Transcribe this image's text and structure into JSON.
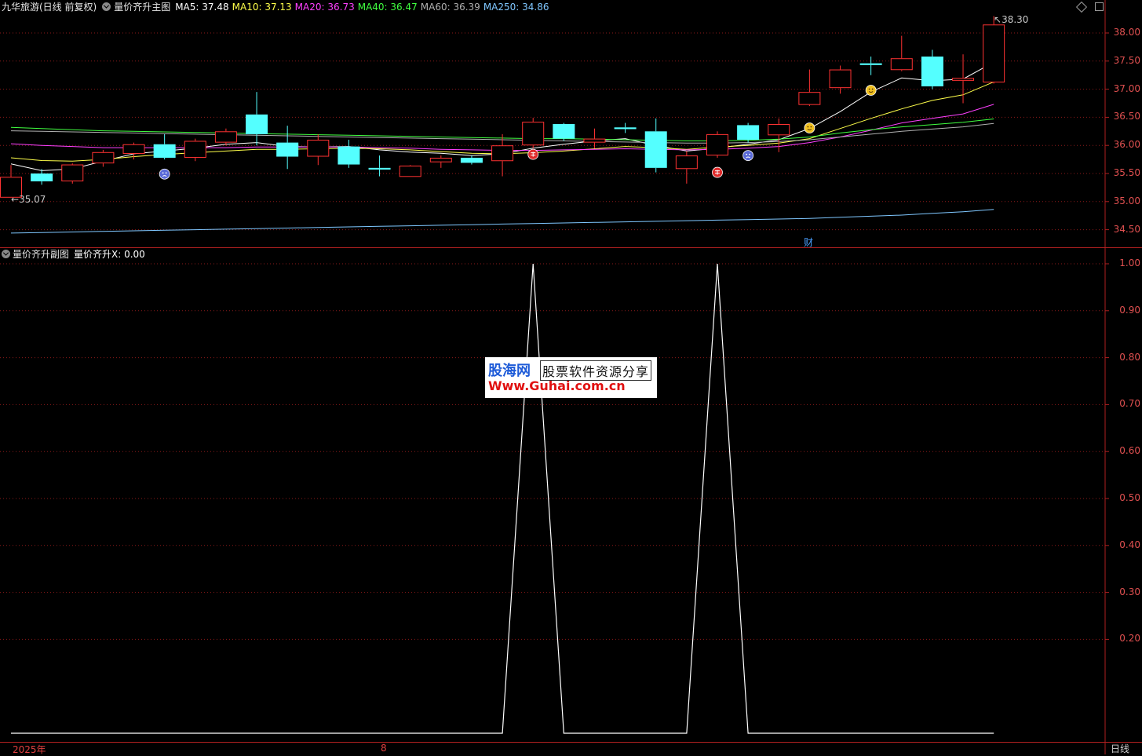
{
  "header": {
    "stock": "九华旅游(日线 前复权)",
    "indicator": "量价齐升主图",
    "ma": [
      {
        "label": "MA5: 37.48",
        "color": "#ffffff"
      },
      {
        "label": "MA10: 37.13",
        "color": "#ffff4a"
      },
      {
        "label": "MA20: 36.73",
        "color": "#ff40ff"
      },
      {
        "label": "MA40: 36.47",
        "color": "#40ff40"
      },
      {
        "label": "MA60: 36.39",
        "color": "#b0b0b0"
      },
      {
        "label": "MA250: 34.86",
        "color": "#7fc7ff"
      }
    ]
  },
  "sub_header": {
    "indicator": "量价齐升副图",
    "value": "量价齐升X: 0.00"
  },
  "main_axis": [
    "38.00",
    "37.50",
    "37.00",
    "36.50",
    "36.00",
    "35.50",
    "35.00",
    "34.50"
  ],
  "sub_axis": [
    "1.00",
    "0.90",
    "0.80",
    "0.70",
    "0.60",
    "0.50",
    "0.40",
    "0.30",
    "0.20"
  ],
  "price_marks": {
    "high": "38.30",
    "low": "35.07"
  },
  "event_label": "财",
  "dates": {
    "year": "2025年",
    "month": "8"
  },
  "period": "日线",
  "watermark": {
    "name": "股海网",
    "slogan": "股票软件资源分享",
    "url": "Www.Guhai.com.cn"
  },
  "colors": {
    "up": "#ff3232",
    "down": "#54ffff",
    "grid": "#8b1a1a",
    "signal": "#ffffff"
  },
  "chart_data": {
    "type": "candlestick",
    "ylim": [
      34.4,
      38.25
    ],
    "candles": [
      {
        "o": 35.44,
        "h": 35.65,
        "l": 35.07,
        "c": 35.07,
        "d": "up"
      },
      {
        "o": 35.5,
        "h": 35.58,
        "l": 35.3,
        "c": 35.36,
        "d": "down"
      },
      {
        "o": 35.36,
        "h": 35.68,
        "l": 35.32,
        "c": 35.66,
        "d": "up"
      },
      {
        "o": 35.68,
        "h": 35.92,
        "l": 35.62,
        "c": 35.88,
        "d": "up"
      },
      {
        "o": 35.85,
        "h": 36.05,
        "l": 35.75,
        "c": 36.02,
        "d": "up"
      },
      {
        "o": 36.02,
        "h": 36.2,
        "l": 35.75,
        "c": 35.78,
        "d": "down"
      },
      {
        "o": 35.78,
        "h": 36.12,
        "l": 35.72,
        "c": 36.08,
        "d": "up"
      },
      {
        "o": 36.05,
        "h": 36.3,
        "l": 36.0,
        "c": 36.25,
        "d": "up"
      },
      {
        "o": 36.55,
        "h": 36.95,
        "l": 36.0,
        "c": 36.2,
        "d": "down"
      },
      {
        "o": 36.05,
        "h": 36.35,
        "l": 35.58,
        "c": 35.8,
        "d": "down"
      },
      {
        "o": 35.8,
        "h": 36.2,
        "l": 35.65,
        "c": 36.1,
        "d": "up"
      },
      {
        "o": 35.98,
        "h": 36.1,
        "l": 35.6,
        "c": 35.66,
        "d": "down"
      },
      {
        "o": 35.6,
        "h": 35.82,
        "l": 35.45,
        "c": 35.57,
        "d": "down"
      },
      {
        "o": 35.44,
        "h": 35.65,
        "l": 35.44,
        "c": 35.64,
        "d": "up"
      },
      {
        "o": 35.7,
        "h": 35.82,
        "l": 35.6,
        "c": 35.78,
        "d": "up"
      },
      {
        "o": 35.78,
        "h": 35.82,
        "l": 35.66,
        "c": 35.69,
        "d": "down"
      },
      {
        "o": 35.72,
        "h": 36.2,
        "l": 35.45,
        "c": 36.0,
        "d": "up"
      },
      {
        "o": 36.0,
        "h": 36.49,
        "l": 35.95,
        "c": 36.42,
        "d": "up"
      },
      {
        "o": 36.38,
        "h": 36.4,
        "l": 36.08,
        "c": 36.12,
        "d": "down"
      },
      {
        "o": 36.12,
        "h": 36.3,
        "l": 35.95,
        "c": 36.05,
        "d": "up"
      },
      {
        "o": 36.32,
        "h": 36.4,
        "l": 36.22,
        "c": 36.29,
        "d": "down"
      },
      {
        "o": 36.25,
        "h": 36.48,
        "l": 35.52,
        "c": 35.6,
        "d": "down"
      },
      {
        "o": 35.58,
        "h": 35.9,
        "l": 35.32,
        "c": 35.82,
        "d": "up"
      },
      {
        "o": 35.82,
        "h": 36.25,
        "l": 35.78,
        "c": 36.2,
        "d": "up"
      },
      {
        "o": 36.36,
        "h": 36.4,
        "l": 36.05,
        "c": 36.1,
        "d": "down"
      },
      {
        "o": 36.18,
        "h": 36.48,
        "l": 35.88,
        "c": 36.38,
        "d": "up"
      },
      {
        "o": 36.72,
        "h": 37.35,
        "l": 36.7,
        "c": 36.95,
        "d": "up"
      },
      {
        "o": 37.02,
        "h": 37.42,
        "l": 36.92,
        "c": 37.35,
        "d": "up"
      },
      {
        "o": 37.43,
        "h": 37.58,
        "l": 37.25,
        "c": 37.46,
        "d": "down"
      },
      {
        "o": 37.34,
        "h": 37.95,
        "l": 37.32,
        "c": 37.55,
        "d": "up"
      },
      {
        "o": 37.58,
        "h": 37.7,
        "l": 37.0,
        "c": 37.05,
        "d": "down"
      },
      {
        "o": 37.15,
        "h": 37.62,
        "l": 36.75,
        "c": 37.2,
        "d": "up"
      },
      {
        "o": 37.12,
        "h": 38.3,
        "l": 37.1,
        "c": 38.15,
        "d": "up"
      }
    ],
    "series": [
      {
        "name": "MA5",
        "color": "#ffffff",
        "values": [
          35.67,
          35.55,
          35.58,
          35.72,
          35.85,
          35.9,
          35.95,
          36.02,
          36.05,
          35.98,
          35.97,
          35.98,
          35.92,
          35.88,
          35.86,
          35.82,
          35.85,
          35.95,
          36.02,
          36.08,
          36.12,
          36.0,
          35.9,
          35.95,
          36.02,
          36.1,
          36.3,
          36.6,
          36.95,
          37.2,
          37.15,
          37.18,
          37.48
        ]
      },
      {
        "name": "MA10",
        "color": "#ffff4a",
        "values": [
          35.78,
          35.73,
          35.72,
          35.75,
          35.8,
          35.84,
          35.87,
          35.9,
          35.93,
          35.93,
          35.94,
          35.95,
          35.94,
          35.92,
          35.89,
          35.86,
          35.85,
          35.87,
          35.9,
          35.94,
          35.98,
          35.96,
          35.93,
          35.97,
          36.0,
          36.04,
          36.12,
          36.3,
          36.48,
          36.65,
          36.8,
          36.9,
          37.13
        ]
      },
      {
        "name": "MA20",
        "color": "#ff40ff",
        "values": [
          36.03,
          36.0,
          35.98,
          35.96,
          35.96,
          35.96,
          35.96,
          35.96,
          35.97,
          35.97,
          35.97,
          35.97,
          35.96,
          35.95,
          35.93,
          35.92,
          35.91,
          35.91,
          35.92,
          35.93,
          35.94,
          35.93,
          35.92,
          35.93,
          35.95,
          35.98,
          36.05,
          36.15,
          36.27,
          36.4,
          36.48,
          36.56,
          36.73
        ]
      },
      {
        "name": "MA40",
        "color": "#40ff40",
        "values": [
          36.32,
          36.3,
          36.28,
          36.26,
          36.25,
          36.24,
          36.23,
          36.22,
          36.21,
          36.2,
          36.19,
          36.18,
          36.17,
          36.16,
          36.15,
          36.14,
          36.13,
          36.12,
          36.12,
          36.11,
          36.1,
          36.09,
          36.08,
          36.08,
          36.09,
          36.11,
          36.15,
          36.22,
          36.28,
          36.33,
          36.37,
          36.41,
          36.47
        ]
      },
      {
        "name": "MA60",
        "color": "#b0b0b0",
        "values": [
          36.26,
          36.25,
          36.24,
          36.23,
          36.22,
          36.21,
          36.2,
          36.19,
          36.18,
          36.17,
          36.16,
          36.15,
          36.14,
          36.13,
          36.12,
          36.11,
          36.1,
          36.09,
          36.08,
          36.07,
          36.06,
          36.05,
          36.04,
          36.04,
          36.05,
          36.07,
          36.1,
          36.15,
          36.2,
          36.25,
          36.29,
          36.33,
          36.39
        ]
      },
      {
        "name": "MA250",
        "color": "#7fc7ff",
        "values": [
          34.44,
          34.45,
          34.46,
          34.47,
          34.48,
          34.49,
          34.5,
          34.51,
          34.52,
          34.53,
          34.54,
          34.55,
          34.56,
          34.57,
          34.58,
          34.59,
          34.6,
          34.61,
          34.62,
          34.63,
          34.64,
          34.65,
          34.66,
          34.67,
          34.68,
          34.69,
          34.7,
          34.72,
          34.74,
          34.76,
          34.79,
          34.82,
          34.86
        ]
      }
    ],
    "markers": [
      {
        "i": 5,
        "kind": "blue-face",
        "price": 35.49
      },
      {
        "i": 17,
        "kind": "red-buy",
        "price": 35.84
      },
      {
        "i": 23,
        "kind": "red-buy",
        "price": 35.52
      },
      {
        "i": 24,
        "kind": "blue-face",
        "price": 35.82
      },
      {
        "i": 26,
        "kind": "yellow-face",
        "price": 36.31
      },
      {
        "i": 28,
        "kind": "yellow-face",
        "price": 36.98
      }
    ],
    "signal": {
      "name": "量价齐升X",
      "ylim": [
        0,
        1.0
      ],
      "values": [
        0,
        0,
        0,
        0,
        0,
        0,
        0,
        0,
        0,
        0,
        0,
        0,
        0,
        0,
        0,
        0,
        0,
        1,
        0,
        0,
        0,
        0,
        0,
        1,
        0,
        0,
        0,
        0,
        0,
        0,
        0,
        0,
        0
      ]
    }
  }
}
